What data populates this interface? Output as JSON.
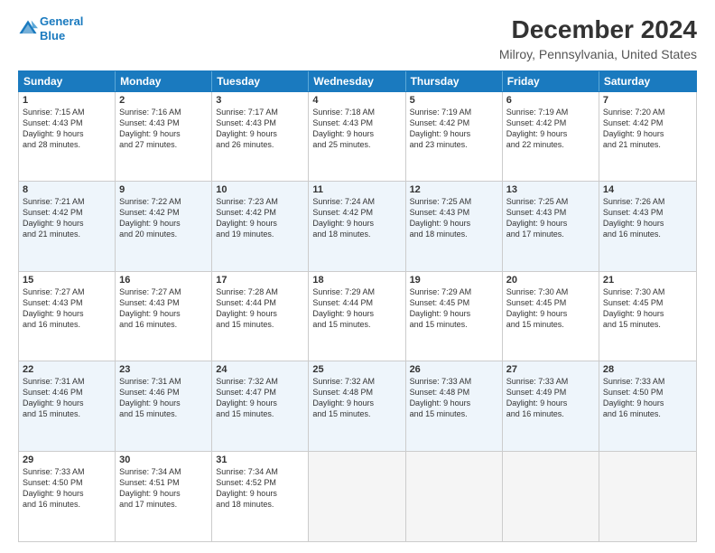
{
  "logo": {
    "line1": "General",
    "line2": "Blue"
  },
  "title": "December 2024",
  "subtitle": "Milroy, Pennsylvania, United States",
  "header_days": [
    "Sunday",
    "Monday",
    "Tuesday",
    "Wednesday",
    "Thursday",
    "Friday",
    "Saturday"
  ],
  "weeks": [
    [
      {
        "day": "1",
        "lines": [
          "Sunrise: 7:15 AM",
          "Sunset: 4:43 PM",
          "Daylight: 9 hours",
          "and 28 minutes."
        ],
        "empty": false,
        "alt": false
      },
      {
        "day": "2",
        "lines": [
          "Sunrise: 7:16 AM",
          "Sunset: 4:43 PM",
          "Daylight: 9 hours",
          "and 27 minutes."
        ],
        "empty": false,
        "alt": false
      },
      {
        "day": "3",
        "lines": [
          "Sunrise: 7:17 AM",
          "Sunset: 4:43 PM",
          "Daylight: 9 hours",
          "and 26 minutes."
        ],
        "empty": false,
        "alt": false
      },
      {
        "day": "4",
        "lines": [
          "Sunrise: 7:18 AM",
          "Sunset: 4:43 PM",
          "Daylight: 9 hours",
          "and 25 minutes."
        ],
        "empty": false,
        "alt": false
      },
      {
        "day": "5",
        "lines": [
          "Sunrise: 7:19 AM",
          "Sunset: 4:42 PM",
          "Daylight: 9 hours",
          "and 23 minutes."
        ],
        "empty": false,
        "alt": false
      },
      {
        "day": "6",
        "lines": [
          "Sunrise: 7:19 AM",
          "Sunset: 4:42 PM",
          "Daylight: 9 hours",
          "and 22 minutes."
        ],
        "empty": false,
        "alt": false
      },
      {
        "day": "7",
        "lines": [
          "Sunrise: 7:20 AM",
          "Sunset: 4:42 PM",
          "Daylight: 9 hours",
          "and 21 minutes."
        ],
        "empty": false,
        "alt": false
      }
    ],
    [
      {
        "day": "8",
        "lines": [
          "Sunrise: 7:21 AM",
          "Sunset: 4:42 PM",
          "Daylight: 9 hours",
          "and 21 minutes."
        ],
        "empty": false,
        "alt": true
      },
      {
        "day": "9",
        "lines": [
          "Sunrise: 7:22 AM",
          "Sunset: 4:42 PM",
          "Daylight: 9 hours",
          "and 20 minutes."
        ],
        "empty": false,
        "alt": true
      },
      {
        "day": "10",
        "lines": [
          "Sunrise: 7:23 AM",
          "Sunset: 4:42 PM",
          "Daylight: 9 hours",
          "and 19 minutes."
        ],
        "empty": false,
        "alt": true
      },
      {
        "day": "11",
        "lines": [
          "Sunrise: 7:24 AM",
          "Sunset: 4:42 PM",
          "Daylight: 9 hours",
          "and 18 minutes."
        ],
        "empty": false,
        "alt": true
      },
      {
        "day": "12",
        "lines": [
          "Sunrise: 7:25 AM",
          "Sunset: 4:43 PM",
          "Daylight: 9 hours",
          "and 18 minutes."
        ],
        "empty": false,
        "alt": true
      },
      {
        "day": "13",
        "lines": [
          "Sunrise: 7:25 AM",
          "Sunset: 4:43 PM",
          "Daylight: 9 hours",
          "and 17 minutes."
        ],
        "empty": false,
        "alt": true
      },
      {
        "day": "14",
        "lines": [
          "Sunrise: 7:26 AM",
          "Sunset: 4:43 PM",
          "Daylight: 9 hours",
          "and 16 minutes."
        ],
        "empty": false,
        "alt": true
      }
    ],
    [
      {
        "day": "15",
        "lines": [
          "Sunrise: 7:27 AM",
          "Sunset: 4:43 PM",
          "Daylight: 9 hours",
          "and 16 minutes."
        ],
        "empty": false,
        "alt": false
      },
      {
        "day": "16",
        "lines": [
          "Sunrise: 7:27 AM",
          "Sunset: 4:43 PM",
          "Daylight: 9 hours",
          "and 16 minutes."
        ],
        "empty": false,
        "alt": false
      },
      {
        "day": "17",
        "lines": [
          "Sunrise: 7:28 AM",
          "Sunset: 4:44 PM",
          "Daylight: 9 hours",
          "and 15 minutes."
        ],
        "empty": false,
        "alt": false
      },
      {
        "day": "18",
        "lines": [
          "Sunrise: 7:29 AM",
          "Sunset: 4:44 PM",
          "Daylight: 9 hours",
          "and 15 minutes."
        ],
        "empty": false,
        "alt": false
      },
      {
        "day": "19",
        "lines": [
          "Sunrise: 7:29 AM",
          "Sunset: 4:45 PM",
          "Daylight: 9 hours",
          "and 15 minutes."
        ],
        "empty": false,
        "alt": false
      },
      {
        "day": "20",
        "lines": [
          "Sunrise: 7:30 AM",
          "Sunset: 4:45 PM",
          "Daylight: 9 hours",
          "and 15 minutes."
        ],
        "empty": false,
        "alt": false
      },
      {
        "day": "21",
        "lines": [
          "Sunrise: 7:30 AM",
          "Sunset: 4:45 PM",
          "Daylight: 9 hours",
          "and 15 minutes."
        ],
        "empty": false,
        "alt": false
      }
    ],
    [
      {
        "day": "22",
        "lines": [
          "Sunrise: 7:31 AM",
          "Sunset: 4:46 PM",
          "Daylight: 9 hours",
          "and 15 minutes."
        ],
        "empty": false,
        "alt": true
      },
      {
        "day": "23",
        "lines": [
          "Sunrise: 7:31 AM",
          "Sunset: 4:46 PM",
          "Daylight: 9 hours",
          "and 15 minutes."
        ],
        "empty": false,
        "alt": true
      },
      {
        "day": "24",
        "lines": [
          "Sunrise: 7:32 AM",
          "Sunset: 4:47 PM",
          "Daylight: 9 hours",
          "and 15 minutes."
        ],
        "empty": false,
        "alt": true
      },
      {
        "day": "25",
        "lines": [
          "Sunrise: 7:32 AM",
          "Sunset: 4:48 PM",
          "Daylight: 9 hours",
          "and 15 minutes."
        ],
        "empty": false,
        "alt": true
      },
      {
        "day": "26",
        "lines": [
          "Sunrise: 7:33 AM",
          "Sunset: 4:48 PM",
          "Daylight: 9 hours",
          "and 15 minutes."
        ],
        "empty": false,
        "alt": true
      },
      {
        "day": "27",
        "lines": [
          "Sunrise: 7:33 AM",
          "Sunset: 4:49 PM",
          "Daylight: 9 hours",
          "and 16 minutes."
        ],
        "empty": false,
        "alt": true
      },
      {
        "day": "28",
        "lines": [
          "Sunrise: 7:33 AM",
          "Sunset: 4:50 PM",
          "Daylight: 9 hours",
          "and 16 minutes."
        ],
        "empty": false,
        "alt": true
      }
    ],
    [
      {
        "day": "29",
        "lines": [
          "Sunrise: 7:33 AM",
          "Sunset: 4:50 PM",
          "Daylight: 9 hours",
          "and 16 minutes."
        ],
        "empty": false,
        "alt": false
      },
      {
        "day": "30",
        "lines": [
          "Sunrise: 7:34 AM",
          "Sunset: 4:51 PM",
          "Daylight: 9 hours",
          "and 17 minutes."
        ],
        "empty": false,
        "alt": false
      },
      {
        "day": "31",
        "lines": [
          "Sunrise: 7:34 AM",
          "Sunset: 4:52 PM",
          "Daylight: 9 hours",
          "and 18 minutes."
        ],
        "empty": false,
        "alt": false
      },
      {
        "day": "",
        "lines": [],
        "empty": true,
        "alt": false
      },
      {
        "day": "",
        "lines": [],
        "empty": true,
        "alt": false
      },
      {
        "day": "",
        "lines": [],
        "empty": true,
        "alt": false
      },
      {
        "day": "",
        "lines": [],
        "empty": true,
        "alt": false
      }
    ]
  ]
}
